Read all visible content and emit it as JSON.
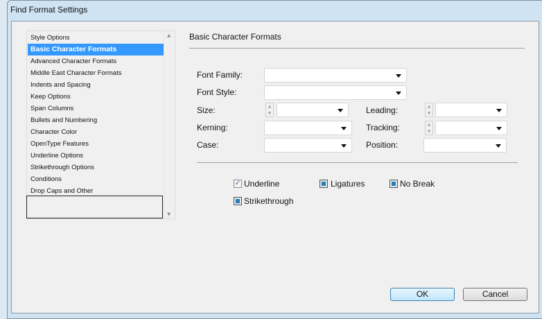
{
  "window": {
    "title": "Find Format Settings"
  },
  "sidebar": {
    "items": [
      {
        "label": "Style Options"
      },
      {
        "label": "Basic Character Formats",
        "selected": true
      },
      {
        "label": "Advanced Character Formats"
      },
      {
        "label": "Middle East Character Formats"
      },
      {
        "label": "Indents and Spacing"
      },
      {
        "label": "Keep Options"
      },
      {
        "label": "Span Columns"
      },
      {
        "label": "Bullets and Numbering"
      },
      {
        "label": "Character Color"
      },
      {
        "label": "OpenType Features"
      },
      {
        "label": "Underline Options"
      },
      {
        "label": "Strikethrough Options"
      },
      {
        "label": "Conditions"
      },
      {
        "label": "Drop Caps and Other"
      }
    ]
  },
  "panel": {
    "title": "Basic Character Formats",
    "font_family": {
      "label": "Font Family:",
      "value": ""
    },
    "font_style": {
      "label": "Font Style:",
      "value": ""
    },
    "size": {
      "label": "Size:",
      "value": ""
    },
    "leading": {
      "label": "Leading:",
      "value": ""
    },
    "kerning": {
      "label": "Kerning:",
      "value": ""
    },
    "tracking": {
      "label": "Tracking:",
      "value": ""
    },
    "case": {
      "label": "Case:",
      "value": ""
    },
    "position": {
      "label": "Position:",
      "value": ""
    },
    "checkboxes": {
      "underline": {
        "label": "Underline",
        "state": "checked"
      },
      "ligatures": {
        "label": "Ligatures",
        "state": "indeterminate"
      },
      "no_break": {
        "label": "No Break",
        "state": "indeterminate"
      },
      "strikethrough": {
        "label": "Strikethrough",
        "state": "indeterminate"
      }
    }
  },
  "buttons": {
    "ok": "OK",
    "cancel": "Cancel"
  }
}
